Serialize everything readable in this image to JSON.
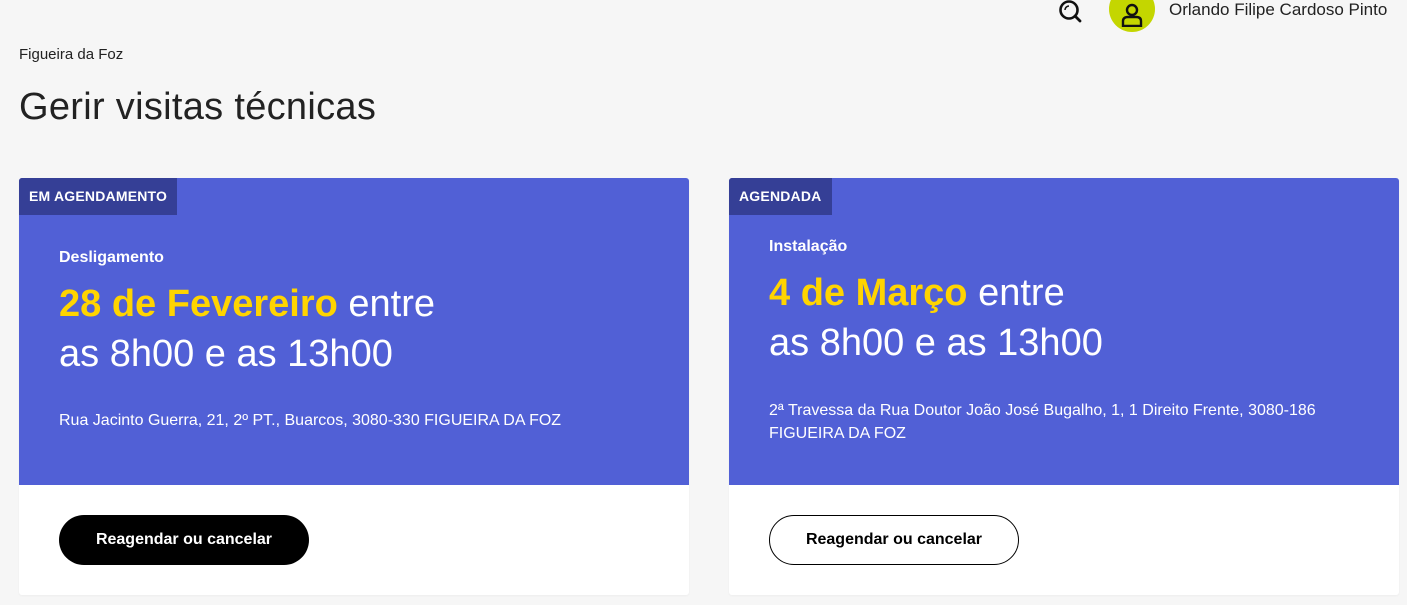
{
  "header": {
    "search_icon": "search-icon",
    "avatar_icon": "user-icon",
    "user_name": "Orlando Filipe Cardoso Pinto",
    "accent_color": "#c4d600"
  },
  "page": {
    "location": "Figueira da Foz",
    "title": "Gerir visitas técnicas"
  },
  "colors": {
    "card_background": "#5160d6",
    "badge_background": "#353f96",
    "date_highlight": "#ffd400"
  },
  "visits": [
    {
      "status": "EM AGENDAMENTO",
      "type": "Desligamento",
      "date": "28 de Fevereiro",
      "connector": " entre",
      "time_range": "as 8h00 e as 13h00",
      "address": "Rua Jacinto Guerra, 21, 2º PT., Buarcos, 3080-330 FIGUEIRA DA FOZ",
      "action_label": "Reagendar ou cancelar"
    },
    {
      "status": "AGENDADA",
      "type": "Instalação",
      "date": "4 de Março",
      "connector": " entre",
      "time_range": "as 8h00 e as 13h00",
      "address": "2ª Travessa da Rua Doutor João José Bugalho, 1, 1 Direito Frente, 3080-186 FIGUEIRA DA FOZ",
      "action_label": "Reagendar ou cancelar"
    }
  ]
}
